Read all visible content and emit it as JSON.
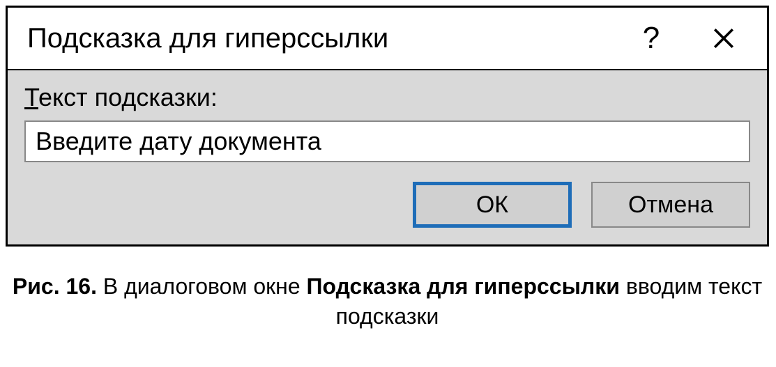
{
  "dialog": {
    "title": "Подсказка для гиперссылки",
    "help_symbol": "?",
    "field_label_prefix": "Т",
    "field_label_rest": "екст подсказки:",
    "input_value": "Введите дату документа",
    "ok_label": "ОК",
    "cancel_label": "Отмена"
  },
  "caption": {
    "fig_label": "Рис. 16.",
    "text_1": " В диалоговом окне ",
    "bold_name": "Подсказка для гиперссылки",
    "text_2": " вводим текст подсказки"
  }
}
